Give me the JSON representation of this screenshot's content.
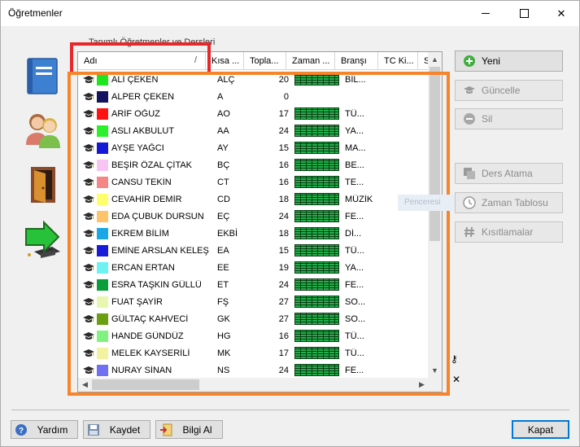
{
  "window": {
    "title": "Öğretmenler"
  },
  "group": {
    "label": "Tanımlı Öğretmenler ve Dersleri"
  },
  "grid": {
    "columns": {
      "name": "Adı",
      "short": "Kısa ...",
      "total": "Topla...",
      "time": "Zaman ...",
      "branch": "Branşı",
      "tc": "TC Ki...",
      "s": "S"
    },
    "rows": [
      {
        "name": "ALİ ÇEKEN",
        "short": "ALÇ",
        "total": "20",
        "branch": "BİL...",
        "color": "#1ee51e",
        "has_time": true
      },
      {
        "name": "ALPER ÇEKEN",
        "short": "A",
        "total": "0",
        "branch": "",
        "color": "#13135e",
        "has_time": false
      },
      {
        "name": "ARİF OĞUZ",
        "short": "AO",
        "total": "17",
        "branch": "TÜ...",
        "color": "#ff1212",
        "has_time": true
      },
      {
        "name": "ASLI AKBULUT",
        "short": "AA",
        "total": "24",
        "branch": "YA...",
        "color": "#2bf02b",
        "has_time": true
      },
      {
        "name": "AYŞE YAĞCI",
        "short": "AY",
        "total": "15",
        "branch": "MA...",
        "color": "#1717d6",
        "has_time": true
      },
      {
        "name": "BEŞİR ÖZAL ÇİTAK",
        "short": "BÇ",
        "total": "16",
        "branch": "BE...",
        "color": "#f8c5f2",
        "has_time": true
      },
      {
        "name": "CANSU TEKİN",
        "short": "CT",
        "total": "16",
        "branch": "TE...",
        "color": "#f48686",
        "has_time": true
      },
      {
        "name": "CEVAHİR DEMİR",
        "short": "CD",
        "total": "18",
        "branch": "MÜZİK",
        "color": "#ffff6e",
        "has_time": true
      },
      {
        "name": "EDA ÇUBUK DURSUN",
        "short": "EÇ",
        "total": "24",
        "branch": "FE...",
        "color": "#ffc369",
        "has_time": true
      },
      {
        "name": "EKREM BİLİM",
        "short": "EKBİ",
        "total": "18",
        "branch": "Dİ...",
        "color": "#1aa7e8",
        "has_time": true
      },
      {
        "name": "EMİNE ARSLAN KELEŞ",
        "short": "EA",
        "total": "15",
        "branch": "TÜ...",
        "color": "#1a1ad9",
        "has_time": true
      },
      {
        "name": "ERCAN ERTAN",
        "short": "EE",
        "total": "19",
        "branch": "YA...",
        "color": "#6cf2f2",
        "has_time": true
      },
      {
        "name": "ESRA TAŞKIN GÜLLÜ",
        "short": "ET",
        "total": "24",
        "branch": "FE...",
        "color": "#0b9d3c",
        "has_time": true
      },
      {
        "name": "FUAT ŞAYİR",
        "short": "FŞ",
        "total": "27",
        "branch": "SO...",
        "color": "#e8f7b0",
        "has_time": true
      },
      {
        "name": "GÜLTAÇ KAHVECİ",
        "short": "GK",
        "total": "27",
        "branch": "SO...",
        "color": "#6b9e12",
        "has_time": true
      },
      {
        "name": "HANDE GÜNDÜZ",
        "short": "HG",
        "total": "16",
        "branch": "TÜ...",
        "color": "#7ff27f",
        "has_time": true
      },
      {
        "name": "MELEK KAYSERİLİ",
        "short": "MK",
        "total": "17",
        "branch": "TÜ...",
        "color": "#f2f2a0",
        "has_time": true
      },
      {
        "name": "NURAY SİNAN",
        "short": "NS",
        "total": "24",
        "branch": "FE...",
        "color": "#7070f2",
        "has_time": true
      }
    ]
  },
  "right_buttons": {
    "new": "Yeni",
    "update": "Güncelle",
    "delete": "Sil",
    "course_assign": "Ders Atama",
    "time_table": "Zaman Tablosu",
    "constraints": "Kısıtlamalar"
  },
  "ghost_text": "Penceresi",
  "bottom_buttons": {
    "help": "Yardım",
    "save": "Kaydet",
    "info": "Bilgi Al",
    "close": "Kapat"
  },
  "colors": {
    "red_highlight": "#e8272b",
    "orange_highlight": "#f7842a",
    "time_green": "#22b14c",
    "focus_blue": "#0078d7"
  }
}
